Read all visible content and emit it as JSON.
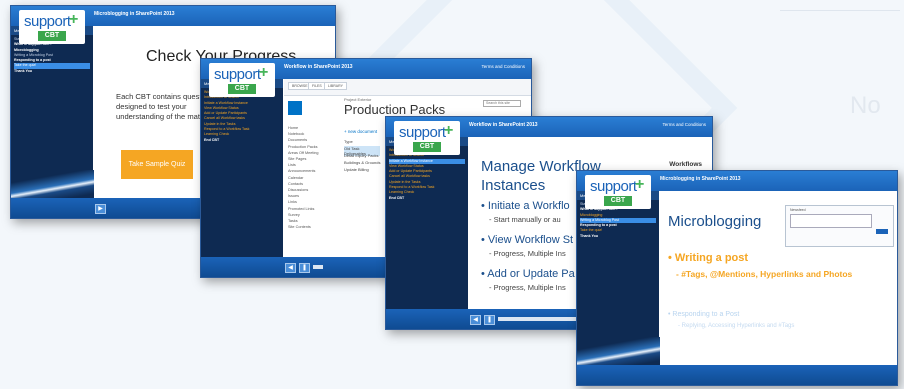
{
  "windows": [
    {
      "title": "Microblogging in SharePoint 2013",
      "terms": "",
      "sidebar_tabs": [
        "Menu",
        "Glossary"
      ],
      "menu": [
        "Start Here: Introduction",
        "What is Support CBT?",
        "Microblogging",
        "Writing a Microblog Post",
        "Responding to a post",
        "Take the quiz!",
        "Thank You"
      ],
      "heading": "Check Your Progress",
      "paragraph": "Each CBT contains questio\ndesigned to test your\nunderstanding of the mate",
      "button": "Take Sample Quiz"
    },
    {
      "title": "Workflow in SharePoint 2013",
      "terms": "Terms and Conditions",
      "sidebar_tabs": [
        "Menu",
        "Glossary"
      ],
      "menu": [
        "Workflow",
        "Introduction to Search",
        "Initiate a Workflow Instance",
        "View Workflow Status",
        "Add or Update Participants",
        "Cancel all Workflow tasks",
        "Update in the Tasks",
        "Respond to a Workflow Task",
        "Learning Check",
        "End CBT"
      ],
      "ribbon_tabs": [
        "BROWSE",
        "FILES",
        "LIBRARY"
      ],
      "subtitle": "Project Exterior",
      "heading": "Production Packs",
      "search": "Search this site",
      "left_nav": [
        "Home",
        "Notebook",
        "Documents",
        "Production Packs",
        "Areas Off Meeting",
        "Site Pages",
        "Lists",
        "Announcements",
        "Calendar",
        "Contacts",
        "Discussions",
        "Issues",
        "Links",
        "Promoted Links",
        "Survey",
        "Tasks",
        "Site Contents"
      ],
      "new_doc": "+ new document",
      "rows": [
        "Type",
        "Old Task Deliverables",
        "Detail Equity Packs",
        "Buildings & Grounds",
        "Update Billing"
      ]
    },
    {
      "title": "Workflow in SharePoint 2013",
      "terms": "Terms and Conditions",
      "sidebar_tabs": [
        "Menu",
        "Glossary"
      ],
      "menu": [
        "Workflow",
        "Introduction to Search",
        "Initiate a Workflow Instance",
        "View Workflow Status",
        "Add or Update Participants",
        "Cancel all Workflow tasks",
        "Update in the Tasks",
        "Respond to a Workflow Task",
        "Learning Check",
        "End CBT"
      ],
      "heading": "Manage Workflow\nInstances",
      "badge": "Workflows",
      "bullets": [
        {
          "text": "• Initiate a Workflo",
          "sub": "- Start manually or au"
        },
        {
          "text": "• View Workflow St",
          "sub": "- Progress, Multiple Ins"
        },
        {
          "text": "• Add or Update Pa",
          "sub": "- Progress, Multiple Ins"
        }
      ]
    },
    {
      "title": "Microblogging in SharePoint 2013",
      "terms": "",
      "sidebar_tabs": [
        "Menu",
        "Glossary"
      ],
      "menu": [
        "Start Here: Introduction",
        "What is Support CBT?",
        "Microblogging",
        "Writing a Microblog Post",
        "Responding to a post",
        "Take the quiz!",
        "Thank You"
      ],
      "heading": "Microblogging",
      "mock_title": "Newsfeed",
      "bullet": "• Writing a post",
      "sub": "- #Tags, @Mentions, Hyperlinks and Photos",
      "faded": "• Responding to a Post",
      "faded_sub": "- Replying, Accessing Hyperlinks and #Tags"
    }
  ],
  "logo": {
    "text": "support",
    "plus": "+",
    "badge": "CBT"
  },
  "background": {
    "text": "No"
  },
  "colors": {
    "accent": "#1b63b8",
    "sidebar": "#0e2a52",
    "orange": "#f5a623",
    "green": "#3aa64c"
  }
}
